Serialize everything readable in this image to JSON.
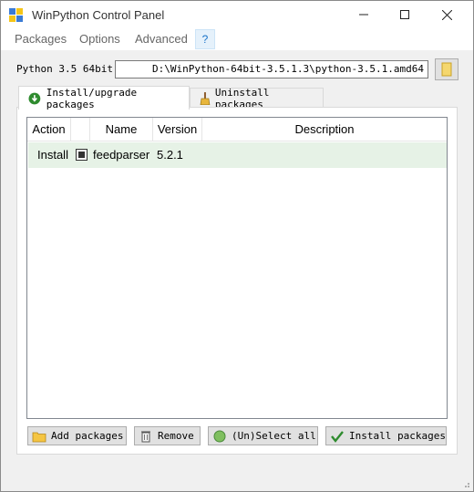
{
  "window": {
    "title": "WinPython Control Panel"
  },
  "menu": {
    "items": [
      "Packages",
      "Options",
      "Advanced"
    ],
    "help": "?"
  },
  "python": {
    "label": "Python 3.5 64bit:",
    "path": "D:\\WinPython-64bit-3.5.1.3\\python-3.5.1.amd64"
  },
  "tabs": [
    {
      "label": "Install/upgrade packages",
      "active": true,
      "icon": "green-download-icon"
    },
    {
      "label": "Uninstall packages",
      "active": false,
      "icon": "broom-icon"
    }
  ],
  "table": {
    "columns": [
      "Action",
      "",
      "Name",
      "Version",
      "Description"
    ],
    "rows": [
      {
        "action": "Install",
        "checked": true,
        "name": "feedparser",
        "version": "5.2.1",
        "description": ""
      }
    ]
  },
  "buttons": {
    "add": "Add packages",
    "remove": "Remove",
    "select_all": "(Un)Select all",
    "install": "Install packages"
  },
  "colors": {
    "row_highlight": "#e6f2e6",
    "accent": "#1a73c9"
  }
}
